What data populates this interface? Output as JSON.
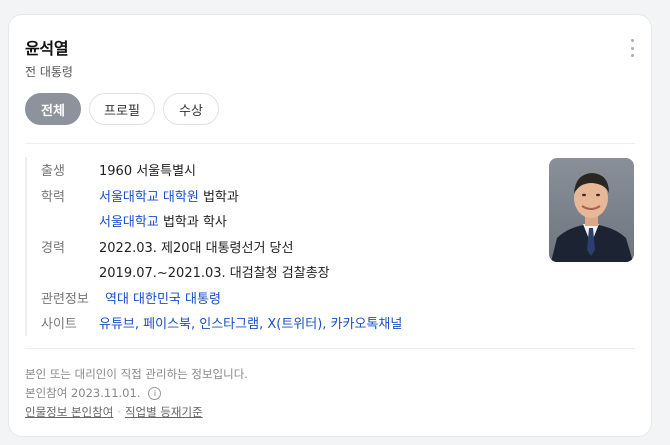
{
  "profile": {
    "name": "윤석열",
    "subtitle": "전 대통령"
  },
  "tabs": [
    {
      "label": "전체",
      "active": true
    },
    {
      "label": "프로필",
      "active": false
    },
    {
      "label": "수상",
      "active": false
    }
  ],
  "info": {
    "birth_label": "출생",
    "birth_value": "1960 서울특별시",
    "edu_label": "학력",
    "edu1_link": "서울대학교 대학원",
    "edu1_rest": " 법학과",
    "edu2_link": "서울대학교",
    "edu2_rest": " 법학과 학사",
    "career_label": "경력",
    "career1": "2022.03. 제20대 대통령선거 당선",
    "career2": "2019.07.~2021.03. 대검찰청 검찰총장",
    "related_label": "관련정보",
    "related_value": "역대 대한민국 대통령",
    "site_label": "사이트",
    "sites": [
      "유튜브",
      "페이스북",
      "인스타그램",
      "X(트위터)",
      "카카오톡채널"
    ],
    "site_sep": ", "
  },
  "footer": {
    "note": "본인 또는 대리인이 직접 관리하는 정보입니다.",
    "participation": "본인참여 2023.11.01.",
    "info_glyph": "i",
    "link1": "인물정보 본인참여",
    "separator": "·",
    "link2": "직업별 등재기준"
  },
  "colors": {
    "link": "#1a4fc9",
    "active_tab": "#8c939c"
  }
}
